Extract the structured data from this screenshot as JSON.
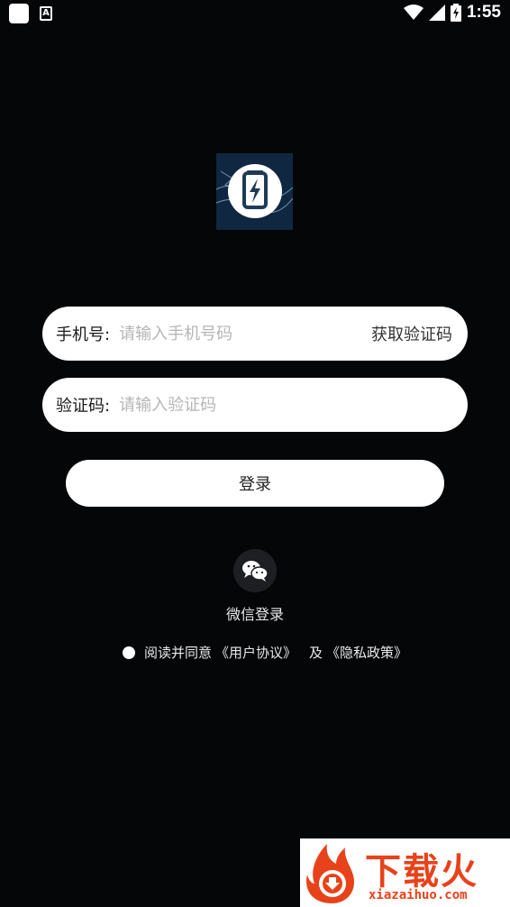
{
  "status_bar": {
    "time": "1:55"
  },
  "phone_field": {
    "label": "手机号:",
    "placeholder": "请输入手机号码",
    "action": "获取验证码"
  },
  "code_field": {
    "label": "验证码:",
    "placeholder": "请输入验证码"
  },
  "login_button": "登录",
  "wechat_login": "微信登录",
  "agreement": {
    "prefix": "阅读并同意",
    "user_agreement": "《用户协议》",
    "and": "及",
    "privacy_policy": "《隐私政策》"
  },
  "watermark": {
    "brand": "下载火",
    "url": "xiazaihuo.com"
  },
  "colors": {
    "background": "#050608",
    "field_bg": "#ffffff",
    "placeholder": "#b5b5b5",
    "watermark": "#e8421a"
  }
}
